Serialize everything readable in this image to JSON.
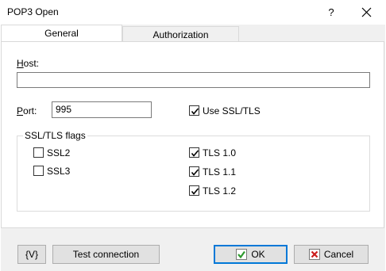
{
  "window": {
    "title": "POP3 Open",
    "help_label": "?"
  },
  "tabs": [
    {
      "label": "General",
      "active": true
    },
    {
      "label": "Authorization",
      "active": false
    }
  ],
  "general": {
    "host_label": "Host:",
    "host_value": "",
    "port_label": "Port:",
    "port_value": "995",
    "use_ssl_label": "Use SSL/TLS",
    "use_ssl_checked": true,
    "ssl_group_title": "SSL/TLS flags",
    "flags": [
      {
        "label": "SSL2",
        "checked": false
      },
      {
        "label": "SSL3",
        "checked": false
      },
      {
        "label": "TLS 1.0",
        "checked": true
      },
      {
        "label": "TLS 1.1",
        "checked": true
      },
      {
        "label": "TLS 1.2",
        "checked": true
      }
    ]
  },
  "footer": {
    "variables_label": "{V}",
    "test_label": "Test connection",
    "ok_label": "OK",
    "cancel_label": "Cancel"
  },
  "colors": {
    "accent": "#0078d7",
    "ok_check": "#2e9a2e",
    "cancel_x": "#cc1f1f"
  },
  "icons": {
    "close": "close-icon",
    "ok": "checkmark-icon",
    "cancel": "cancel-x-icon"
  }
}
